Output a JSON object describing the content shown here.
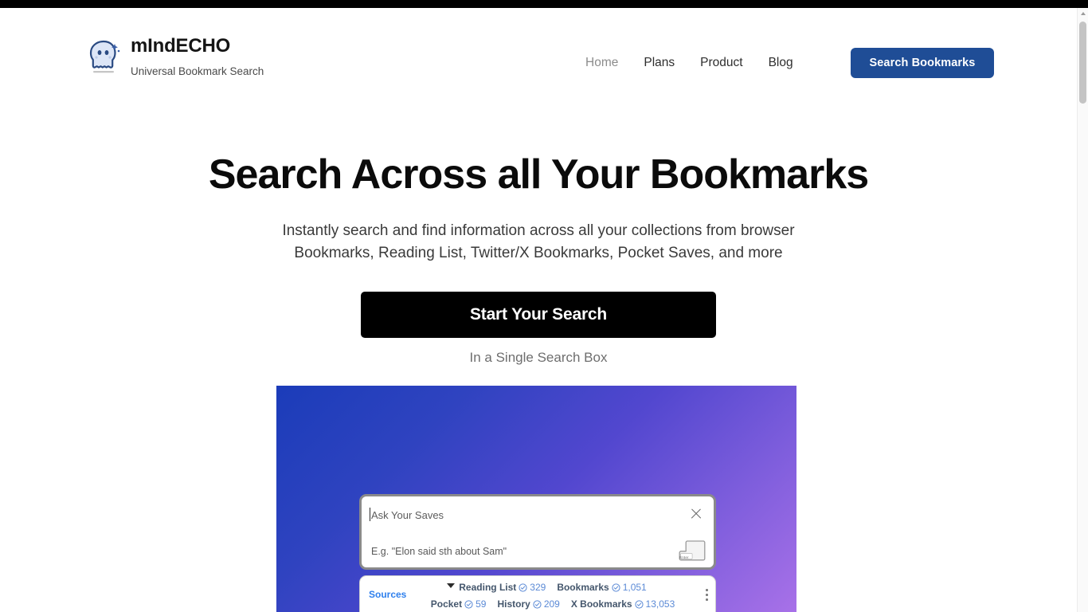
{
  "browser": {
    "scrollbar": {
      "up_arrow_icon": "chevron-up-icon",
      "thumb_icon": "scrollbar-thumb"
    }
  },
  "header": {
    "logo_icon": "cloud-ghost-sparkle-icon",
    "brand_name": "mIndECHO",
    "brand_tagline": "Universal Bookmark Search",
    "nav": [
      {
        "label": "Home",
        "active": false,
        "muted": true
      },
      {
        "label": "Plans",
        "active": false,
        "muted": false
      },
      {
        "label": "Product",
        "active": false,
        "muted": false
      },
      {
        "label": "Blog",
        "active": false,
        "muted": false
      }
    ],
    "cta_label": "Search Bookmarks",
    "cta_color": "#1f4d96"
  },
  "hero": {
    "title": "Search Across all Your Bookmarks",
    "subtitle_line1": "Instantly search and find information across all your collections from browser",
    "subtitle_line2": "Bookmarks, Reading List, Twitter/X Bookmarks, Pocket Saves, and more",
    "cta_label": "Start Your Search",
    "cta_color": "#000000",
    "cta_note": "In a Single Search Box"
  },
  "mockup": {
    "gradient_from": "#1b3cb9",
    "gradient_to": "#a871e8",
    "search": {
      "placeholder": "Ask Your Saves",
      "example": "E.g. \"Elon said sth about Sam\"",
      "close_icon": "close-icon",
      "enter_key_label": "Enter",
      "enter_key_icon": "enter-key-icon"
    },
    "sources": {
      "label": "Sources",
      "chevron_icon": "chevron-down-icon",
      "menu_icon": "kebab-menu-icon",
      "check_icon": "check-circle-icon",
      "row1": [
        {
          "name": "Reading List",
          "count": "329"
        },
        {
          "name": "Bookmarks",
          "count": "1,051"
        }
      ],
      "row2": [
        {
          "name": "Pocket",
          "count": "59"
        },
        {
          "name": "History",
          "count": "209"
        },
        {
          "name": "X Bookmarks",
          "count": "13,053"
        }
      ]
    }
  }
}
